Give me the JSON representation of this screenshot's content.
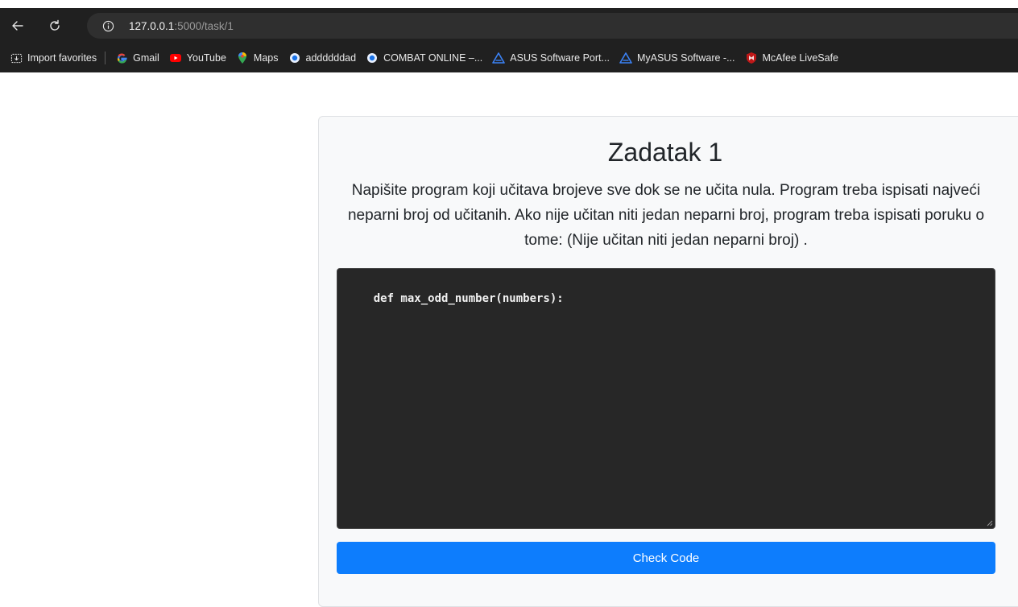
{
  "browser": {
    "url_host": "127.0.0.1",
    "url_path": ":5000/task/1",
    "bookmarks": [
      {
        "label": "Import favorites",
        "icon": "import-icon"
      },
      {
        "label": "Gmail",
        "icon": "google-icon"
      },
      {
        "label": "YouTube",
        "icon": "youtube-icon"
      },
      {
        "label": "Maps",
        "icon": "maps-pin-icon"
      },
      {
        "label": "addddddad",
        "icon": "site-dot-icon"
      },
      {
        "label": "COMBAT ONLINE –...",
        "icon": "site-dot-icon"
      },
      {
        "label": "ASUS Software Port...",
        "icon": "asus-icon"
      },
      {
        "label": "MyASUS Software -...",
        "icon": "asus-icon"
      },
      {
        "label": "McAfee LiveSafe",
        "icon": "mcafee-icon"
      }
    ]
  },
  "task": {
    "title": "Zadatak 1",
    "description": "Napišite program koji učitava brojeve sve dok se ne učita nula. Program treba ispisati najveći neparni broj od učitanih. Ako nije učitan niti jedan neparni broj, program treba ispisati poruku o tome: (Nije učitan niti jedan neparni broj) .",
    "code": "def max_odd_number(numbers):",
    "check_label": "Check Code"
  },
  "colors": {
    "chrome_bg": "#202020",
    "button_primary": "#0d7dfd",
    "editor_bg": "#272727"
  }
}
